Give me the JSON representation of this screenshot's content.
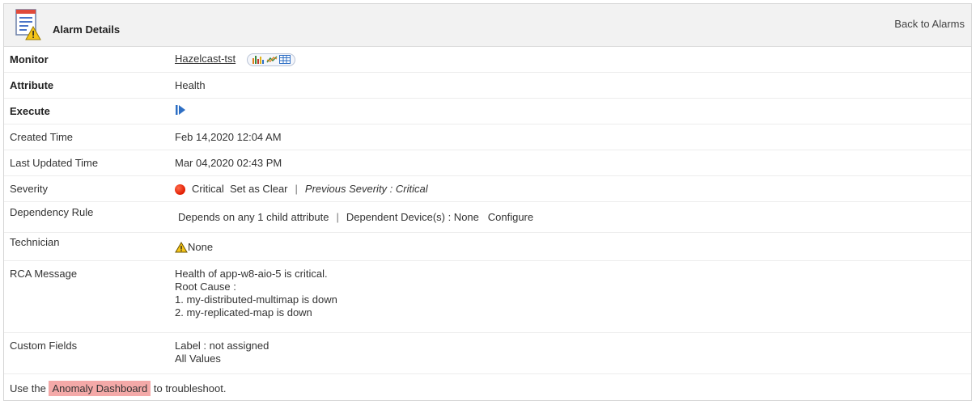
{
  "header": {
    "title": "Alarm Details",
    "back_link": "Back to Alarms"
  },
  "rows": {
    "monitor": {
      "label": "Monitor",
      "value": "Hazelcast-tst"
    },
    "attribute": {
      "label": "Attribute",
      "value": "Health"
    },
    "execute": {
      "label": "Execute"
    },
    "created": {
      "label": "Created  Time",
      "value": "Feb 14,2020 12:04 AM"
    },
    "updated": {
      "label": "Last Updated  Time",
      "value": "Mar 04,2020 02:43 PM"
    },
    "severity": {
      "label": "Severity",
      "value": "Critical",
      "set_clear": "Set as Clear",
      "separator": "|",
      "previous": "Previous Severity : Critical"
    },
    "dependency": {
      "label": "Dependency Rule",
      "rule": "Depends on any 1 child attribute",
      "separator": "|",
      "devices": "Dependent Device(s) :  None",
      "configure": "Configure"
    },
    "technician": {
      "label": "Technician",
      "value": "None"
    },
    "rca": {
      "label": "RCA Message",
      "lines": [
        "Health of app-w8-aio-5 is critical.",
        "Root Cause :",
        "1. my-distributed-multimap is down",
        "2. my-replicated-map is down"
      ]
    },
    "custom": {
      "label": "Custom Fields",
      "line1": "Label : not assigned",
      "line2": "All Values"
    }
  },
  "footer": {
    "prefix": "Use the",
    "link": "Anomaly Dashboard",
    "suffix": "to troubleshoot."
  },
  "colors": {
    "severity_critical": "#e01b00",
    "highlight": "#f4a9a8",
    "execute_icon": "#2e6fc4"
  }
}
